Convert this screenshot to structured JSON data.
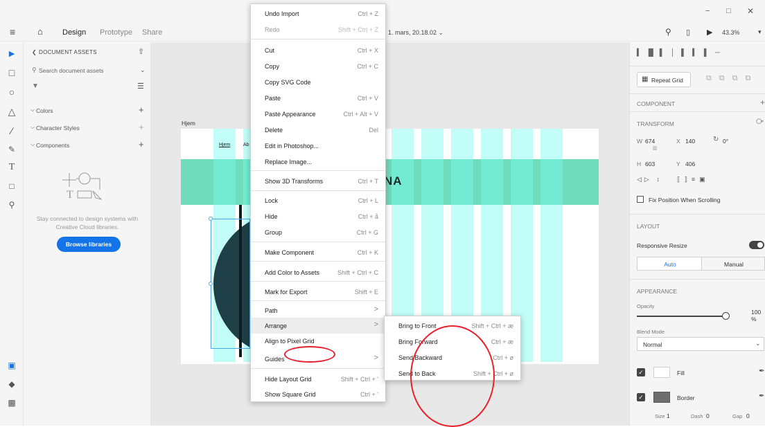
{
  "window": {
    "minimize": "−",
    "restore": "□",
    "close": "✕"
  },
  "topbar": {
    "design_tab": "Design",
    "prototype_tab": "Prototype",
    "share_tab": "Share",
    "doc_title": "1. mars, 20.18.02 ⌄",
    "zoom": "43.3%"
  },
  "assets": {
    "header": "DOCUMENT ASSETS",
    "search_placeholder": "Search document assets",
    "colors": "Colors",
    "character_styles": "Character Styles",
    "components": "Components",
    "empty_text_1": "Stay connected to design systems with",
    "empty_text_2": "Creative Cloud libraries.",
    "browse_button": "Browse libraries"
  },
  "artboard": {
    "name": "Hjem",
    "nav_link": "Hjem",
    "nav_link_2": "Ab",
    "logo_text": "NA"
  },
  "context_menu": {
    "items": [
      {
        "label": "Undo Import",
        "shortcut": "Ctrl + Z"
      },
      {
        "label": "Redo",
        "shortcut": "Shift + Ctrl + Z"
      },
      {
        "label": "Cut",
        "shortcut": "Ctrl + X"
      },
      {
        "label": "Copy",
        "shortcut": "Ctrl + C"
      },
      {
        "label": "Copy SVG Code",
        "shortcut": ""
      },
      {
        "label": "Paste",
        "shortcut": "Ctrl + V"
      },
      {
        "label": "Paste Appearance",
        "shortcut": "Ctrl + Alt + V"
      },
      {
        "label": "Delete",
        "shortcut": "Del"
      },
      {
        "label": "Edit in Photoshop...",
        "shortcut": ""
      },
      {
        "label": "Replace Image...",
        "shortcut": ""
      },
      {
        "label": "Show 3D Transforms",
        "shortcut": "Ctrl + T"
      },
      {
        "label": "Lock",
        "shortcut": "Ctrl + L"
      },
      {
        "label": "Hide",
        "shortcut": "Ctrl + å"
      },
      {
        "label": "Group",
        "shortcut": "Ctrl + G"
      },
      {
        "label": "Make Component",
        "shortcut": "Ctrl + K"
      },
      {
        "label": "Add Color to Assets",
        "shortcut": "Shift + Ctrl + C"
      },
      {
        "label": "Mark for Export",
        "shortcut": "Shift + E"
      },
      {
        "label": "Path",
        "shortcut": ">"
      },
      {
        "label": "Arrange",
        "shortcut": ">"
      },
      {
        "label": "Align to Pixel Grid",
        "shortcut": ""
      },
      {
        "label": "Guides",
        "shortcut": ">"
      },
      {
        "label": "Hide Layout Grid",
        "shortcut": "Shift + Ctrl + '"
      },
      {
        "label": "Show Square Grid",
        "shortcut": "Ctrl + '"
      }
    ]
  },
  "submenu": {
    "items": [
      {
        "label": "Bring to Front",
        "shortcut": "Shift + Ctrl + æ"
      },
      {
        "label": "Bring Forward",
        "shortcut": "Ctrl + æ"
      },
      {
        "label": "Send Backward",
        "shortcut": "Ctrl + ø"
      },
      {
        "label": "Send to Back",
        "shortcut": "Shift + Ctrl + ø"
      }
    ]
  },
  "props": {
    "repeat_grid": "Repeat Grid",
    "component_header": "COMPONENT",
    "transform_header": "TRANSFORM",
    "w_label": "W",
    "w": "674",
    "x_label": "X",
    "x": "140",
    "rot": "0°",
    "h_label": "H",
    "h": "603",
    "y_label": "Y",
    "y": "406",
    "fix_position": "Fix Position When Scrolling",
    "layout_header": "LAYOUT",
    "responsive_resize": "Responsive Resize",
    "auto": "Auto",
    "manual": "Manual",
    "appearance_header": "APPEARANCE",
    "opacity_label": "Opacity",
    "opacity": "100 %",
    "blend_label": "Blend Mode",
    "blend_value": "Normal",
    "fill": "Fill",
    "border": "Border",
    "size_label": "Size",
    "size": "1",
    "dash_label": "Dash",
    "dash": "0",
    "gap_label": "Gap",
    "gap": "0"
  },
  "colors": {
    "accent": "#1473e6",
    "teal": "#6fdcbb",
    "grid": "#78faf0",
    "circle": "#1e3f45",
    "annotation": "#e8202a"
  }
}
